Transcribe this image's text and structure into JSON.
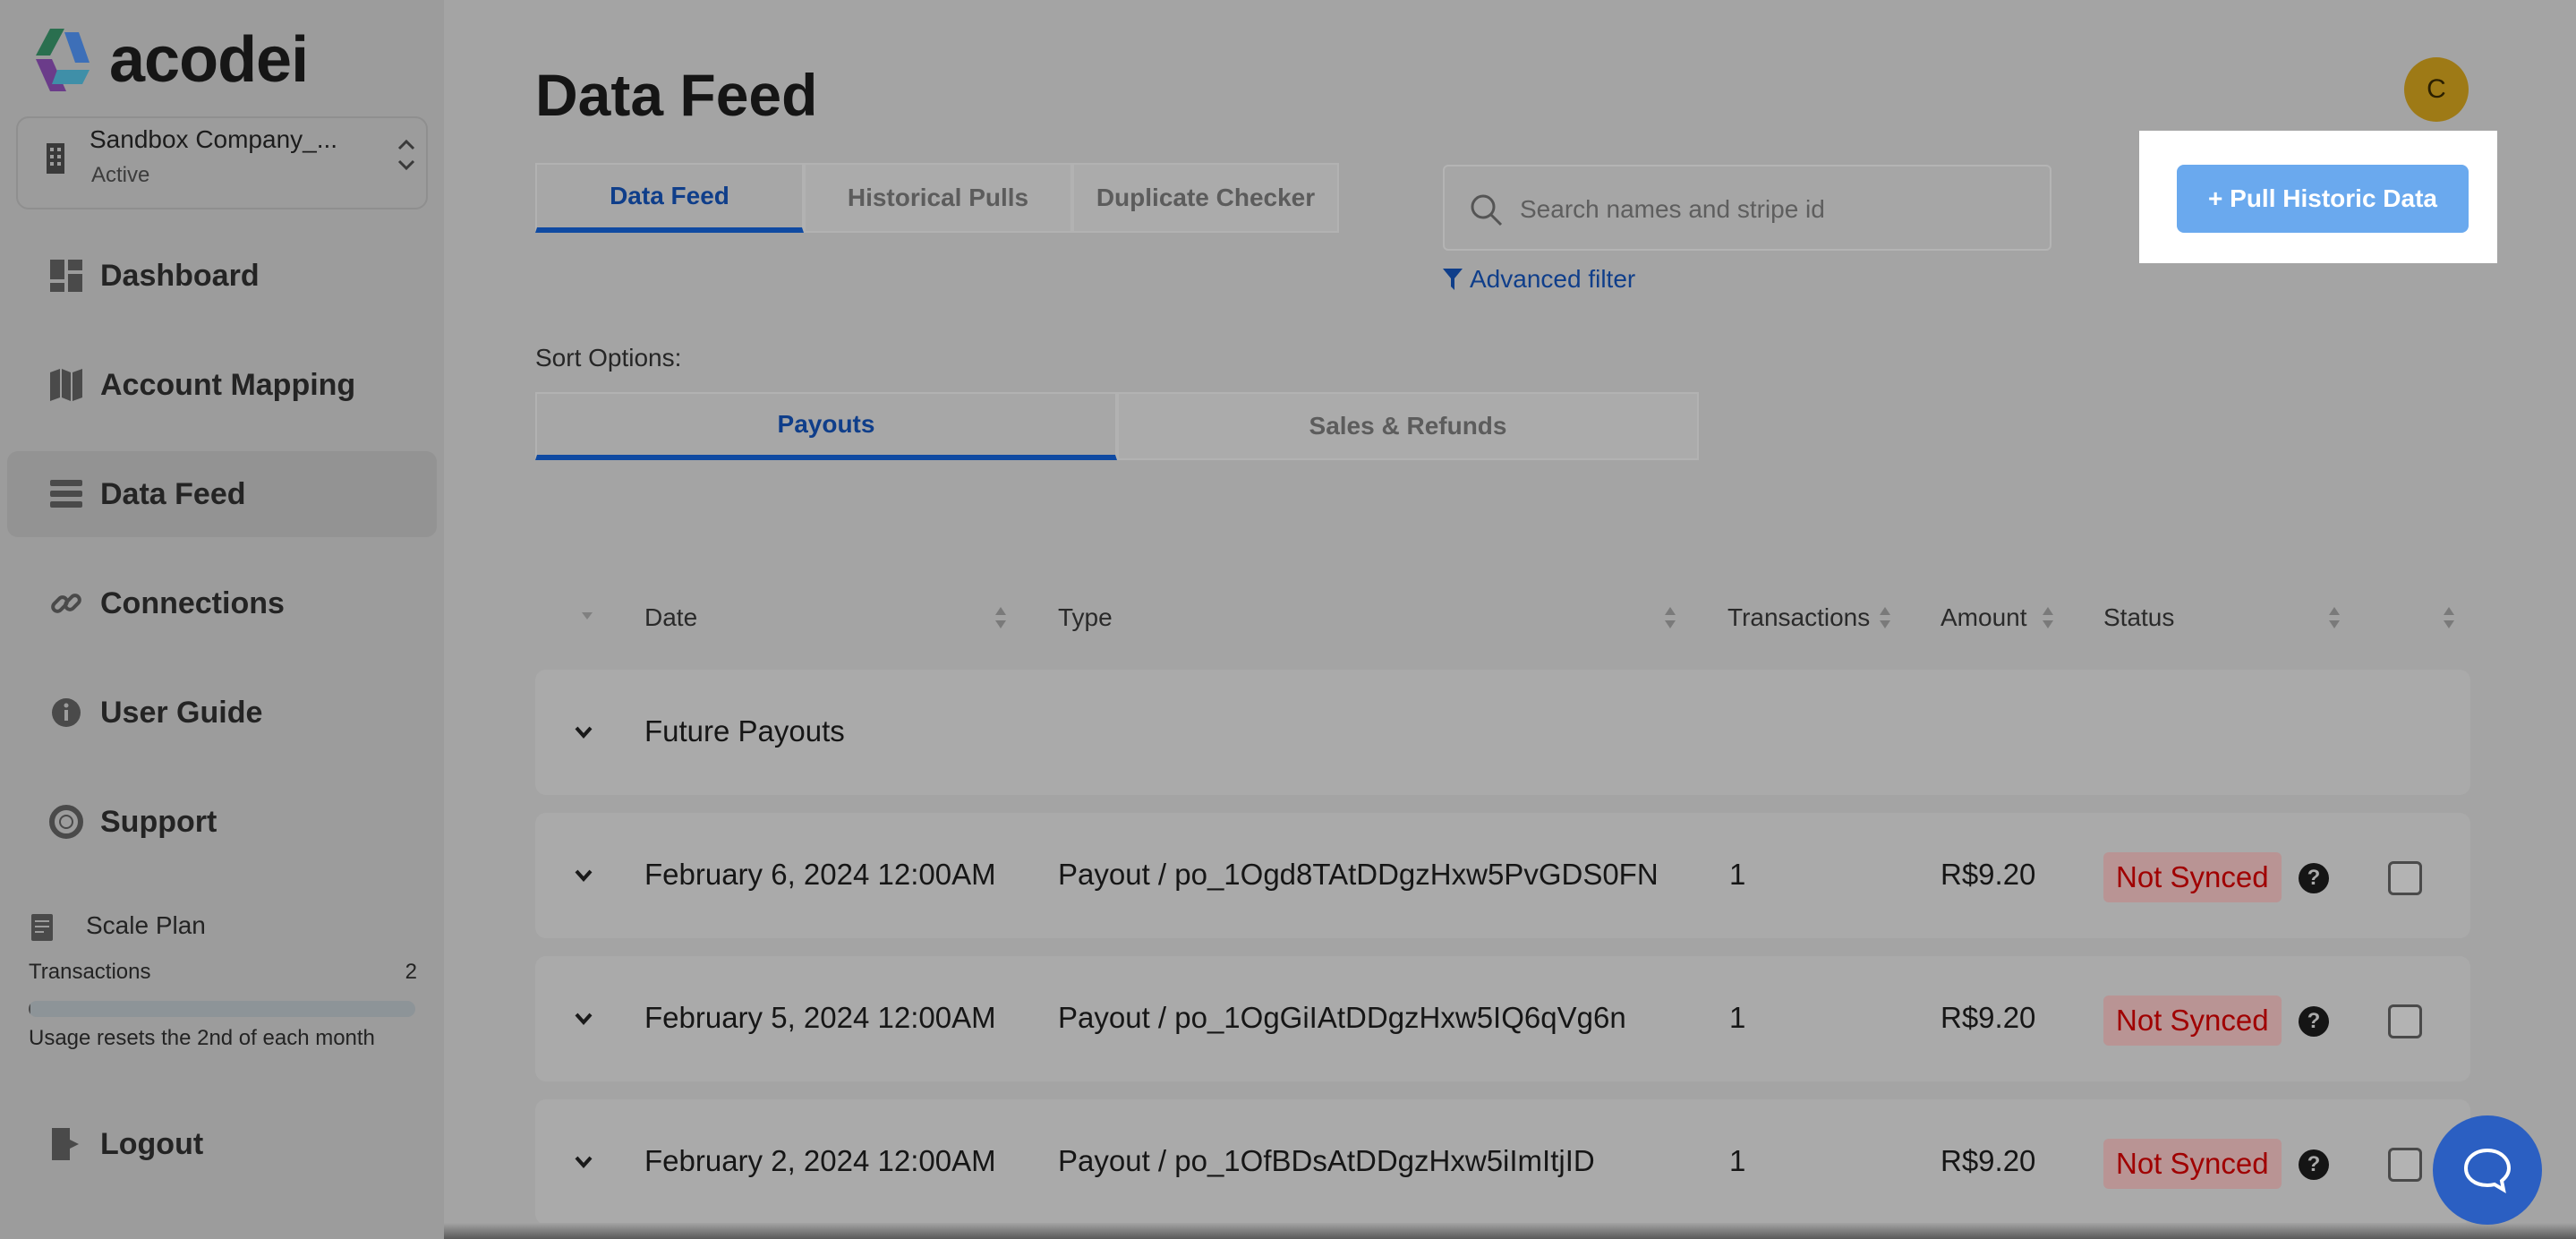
{
  "app": {
    "logo_text": "acodei"
  },
  "company": {
    "name": "Sandbox Company_...",
    "status": "Active"
  },
  "nav": [
    {
      "label": "Dashboard",
      "icon": "dashboard-icon"
    },
    {
      "label": "Account Mapping",
      "icon": "map-icon"
    },
    {
      "label": "Data Feed",
      "icon": "list-icon",
      "active": true
    },
    {
      "label": "Connections",
      "icon": "link-icon"
    },
    {
      "label": "User Guide",
      "icon": "info-icon"
    },
    {
      "label": "Support",
      "icon": "lifebuoy-icon"
    }
  ],
  "plan": {
    "name": "Scale Plan",
    "transactions_label": "Transactions",
    "transactions_count": "2",
    "usage_fraction": 0.005,
    "reset_note": "Usage resets the 2nd of each month"
  },
  "logout_label": "Logout",
  "page_title": "Data Feed",
  "avatar_initial": "C",
  "tabs": [
    "Data Feed",
    "Historical Pulls",
    "Duplicate Checker"
  ],
  "search": {
    "placeholder": "Search names and stripe id",
    "value": ""
  },
  "advanced_filter_label": "Advanced filter",
  "pull_button_label": "+ Pull Historic Data",
  "sort": {
    "label": "Sort Options:",
    "options": [
      "Payouts",
      "Sales & Refunds"
    ]
  },
  "table": {
    "columns": [
      "Date",
      "Type",
      "Transactions",
      "Amount",
      "Status"
    ],
    "group_label": "Future Payouts",
    "rows": [
      {
        "date": "February 6, 2024 12:00AM",
        "type": "Payout / po_1Ogd8TAtDDgzHxw5PvGDS0FN",
        "transactions": "1",
        "amount": "R$9.20",
        "status": "Not Synced"
      },
      {
        "date": "February 5, 2024 12:00AM",
        "type": "Payout / po_1OgGiIAtDDgzHxw5IQ6qVg6n",
        "transactions": "1",
        "amount": "R$9.20",
        "status": "Not Synced"
      },
      {
        "date": "February 2, 2024 12:00AM",
        "type": "Payout / po_1OfBDsAtDDgzHxw5iImItjID",
        "transactions": "1",
        "amount": "R$9.20",
        "status": "Not Synced"
      }
    ]
  },
  "colors": {
    "accent": "#0f4aa2",
    "button": "#6aa9ee",
    "status_red": "#a00000",
    "avatar": "#9e7a16",
    "help": "#2b5fc2"
  }
}
